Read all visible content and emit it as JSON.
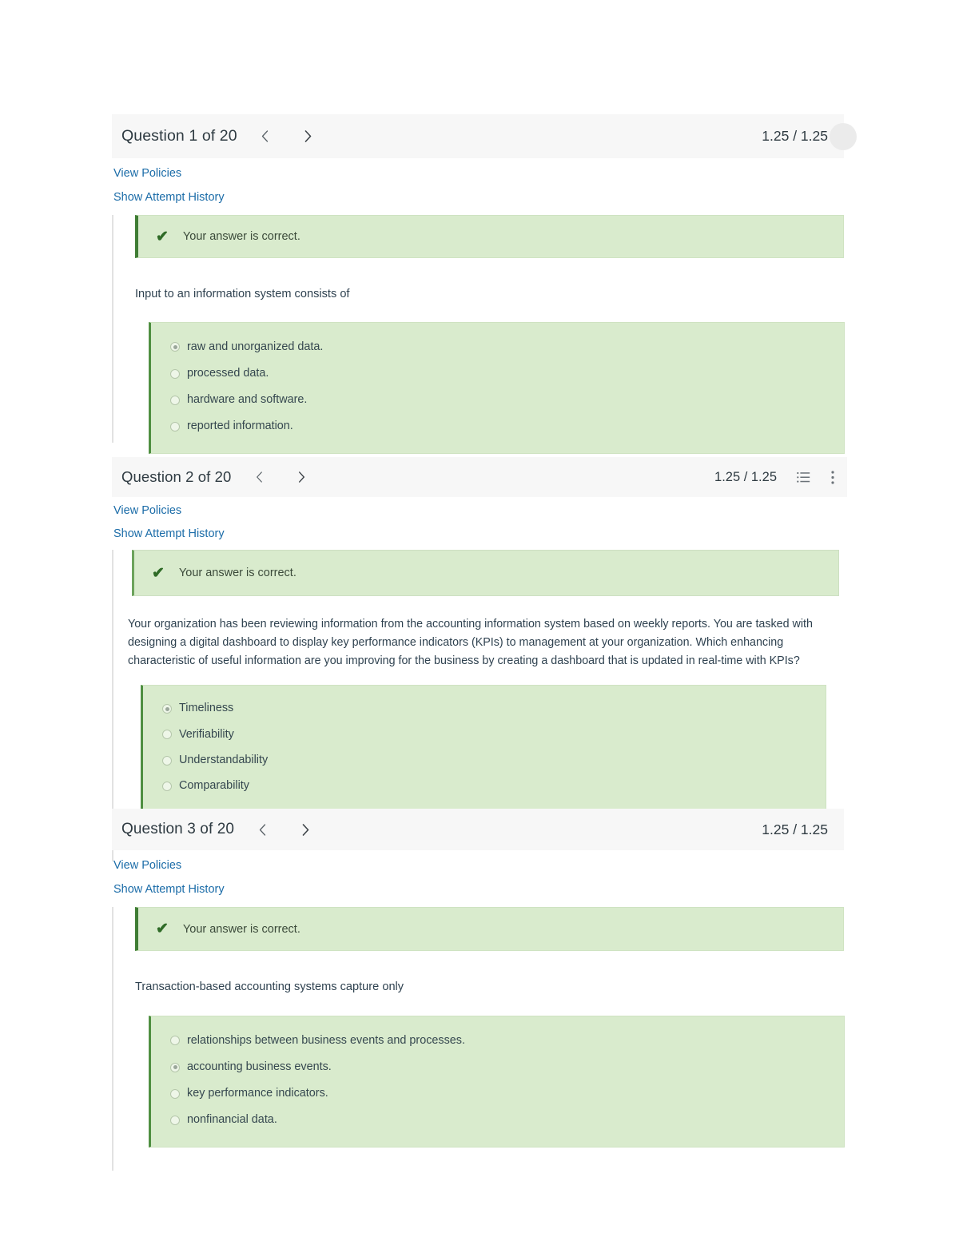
{
  "page": {
    "background_color": "#ffffff",
    "header_background_color": "#f7f7f7",
    "link_color": "#1b6ca8",
    "correct_banner_color": "#d9ebcd",
    "correct_banner_border_color": "#3f7d34",
    "options_panel_color": "#d9ebcd"
  },
  "questions": [
    {
      "title": "Question 1 of 20",
      "score": "1.25 / 1.25",
      "prev_label": "‹",
      "next_label": "›",
      "view_policies_label": "View Policies",
      "show_attempt_history_label": "Show Attempt History",
      "feedback": "Your answer is correct.",
      "check_glyph": "✔",
      "prompt": "Input to an information system consists of",
      "has_list_icon": false,
      "has_menu_icon": false,
      "options": [
        {
          "label": "raw and unorganized data.",
          "selected": true
        },
        {
          "label": "processed data.",
          "selected": false
        },
        {
          "label": "hardware and software.",
          "selected": false
        },
        {
          "label": "reported information.",
          "selected": false
        }
      ]
    },
    {
      "title": "Question 2 of 20",
      "score": "1.25 / 1.25",
      "prev_label": "‹",
      "next_label": "›",
      "view_policies_label": "View Policies",
      "show_attempt_history_label": "Show Attempt History",
      "feedback": "Your answer is correct.",
      "check_glyph": "✔",
      "prompt": "Your organization has been reviewing information from the accounting information system based on weekly reports. You are tasked with designing a digital dashboard to display key performance indicators (KPIs) to management at your organization. Which enhancing characteristic of useful information are you improving for the business by creating a dashboard that is updated in real-time with KPIs?",
      "has_list_icon": true,
      "has_menu_icon": true,
      "options": [
        {
          "label": "Timeliness",
          "selected": true
        },
        {
          "label": "Verifiability",
          "selected": false
        },
        {
          "label": "Understandability",
          "selected": false
        },
        {
          "label": "Comparability",
          "selected": false
        }
      ]
    },
    {
      "title": "Question 3 of 20",
      "score": "1.25 / 1.25",
      "prev_label": "‹",
      "next_label": "›",
      "view_policies_label": "View Policies",
      "show_attempt_history_label": "Show Attempt History",
      "feedback": "Your answer is correct.",
      "check_glyph": "✔",
      "prompt": "Transaction-based accounting systems capture only",
      "has_list_icon": false,
      "has_menu_icon": false,
      "options": [
        {
          "label": "relationships between business events and processes.",
          "selected": false
        },
        {
          "label": "accounting business events.",
          "selected": true
        },
        {
          "label": "key performance indicators.",
          "selected": false
        },
        {
          "label": "nonfinancial data.",
          "selected": false
        }
      ]
    }
  ]
}
